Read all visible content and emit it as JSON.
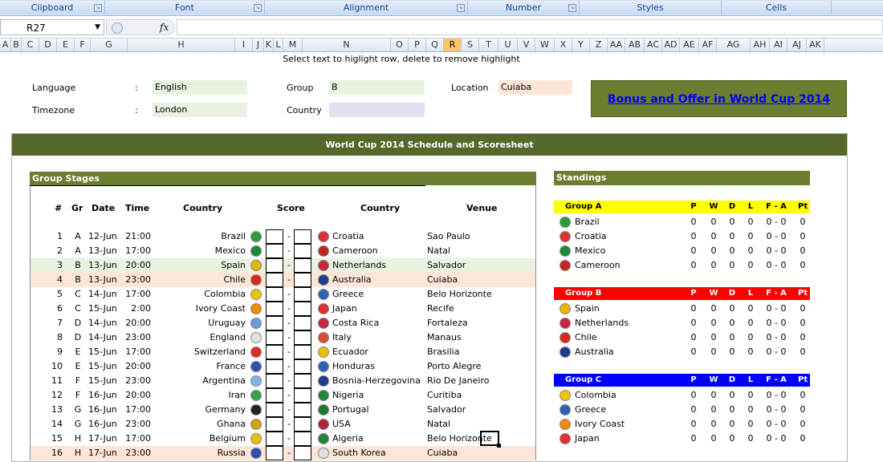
{
  "ribbon": {
    "groups": [
      "Clipboard",
      "Font",
      "Alignment",
      "Number",
      "Styles",
      "Cells"
    ]
  },
  "formula_bar": {
    "name_box": "R27",
    "fx": "fx",
    "formula": ""
  },
  "columns": [
    "A",
    "B",
    "C",
    "D",
    "E",
    "F",
    "G",
    "H",
    "I",
    "J",
    "K",
    "L",
    "M",
    "N",
    "O",
    "P",
    "Q",
    "R",
    "S",
    "T",
    "U",
    "V",
    "W",
    "X",
    "Y",
    "Z",
    "AA",
    "AB",
    "AC",
    "AD",
    "AE",
    "AF",
    "AG",
    "AH",
    "AI",
    "AJ",
    "AK"
  ],
  "selected_column": "R",
  "hint": "Select text to higlight row, delete to remove highlight",
  "settings": {
    "language_label": "Language",
    "language_value": "English",
    "timezone_label": "Timezone",
    "timezone_value": "London",
    "group_label": "Group",
    "group_value": "B",
    "country_label": "Country",
    "country_value": "",
    "location_label": "Location",
    "location_value": "Cuiaba",
    "colon": ":"
  },
  "banner": "Bonus and Offer in World Cup 2014",
  "main_title": "World Cup 2014 Schedule and Scoresheet",
  "group_stages": {
    "title": "Group Stages",
    "headers": {
      "num": "#",
      "gr": "Gr",
      "date": "Date",
      "time": "Time",
      "country_home": "Country",
      "score": "Score",
      "country_away": "Country",
      "venue": "Venue"
    },
    "matches": [
      {
        "num": "1",
        "gr": "A",
        "date": "12-Jun",
        "time": "21:00",
        "home": "Brazil",
        "away": "Croatia",
        "venue": "Sao Paulo",
        "hl": "",
        "home_flag": "#2a9d3a",
        "away_flag": "#d33"
      },
      {
        "num": "2",
        "gr": "A",
        "date": "13-Jun",
        "time": "17:00",
        "home": "Mexico",
        "away": "Cameroon",
        "venue": "Natal",
        "hl": "",
        "home_flag": "#1a8a3a",
        "away_flag": "#c2261f"
      },
      {
        "num": "3",
        "gr": "B",
        "date": "13-Jun",
        "time": "20:00",
        "home": "Spain",
        "away": "Netherlands",
        "venue": "Salvador",
        "hl": "green",
        "home_flag": "#e8b300",
        "away_flag": "#c8283c"
      },
      {
        "num": "4",
        "gr": "B",
        "date": "13-Jun",
        "time": "23:00",
        "home": "Chile",
        "away": "Australia",
        "venue": "Cuiaba",
        "hl": "peach",
        "home_flag": "#d52b1e",
        "away_flag": "#1f3b8c"
      },
      {
        "num": "5",
        "gr": "C",
        "date": "14-Jun",
        "time": "17:00",
        "home": "Colombia",
        "away": "Greece",
        "venue": "Belo Horizonte",
        "hl": "",
        "home_flag": "#f0c300",
        "away_flag": "#2f63b8"
      },
      {
        "num": "6",
        "gr": "C",
        "date": "15-Jun",
        "time": "2:00",
        "home": "Ivory Coast",
        "away": "Japan",
        "venue": "Recife",
        "hl": "",
        "home_flag": "#f08a00",
        "away_flag": "#e03030"
      },
      {
        "num": "7",
        "gr": "D",
        "date": "14-Jun",
        "time": "20:00",
        "home": "Uruguay",
        "away": "Costa Rica",
        "venue": "Fortaleza",
        "hl": "",
        "home_flag": "#6a9ad8",
        "away_flag": "#c8283c"
      },
      {
        "num": "8",
        "gr": "D",
        "date": "14-Jun",
        "time": "23:00",
        "home": "England",
        "away": "Italy",
        "venue": "Manaus",
        "hl": "",
        "home_flag": "#e0e0e0",
        "away_flag": "#d84a3a"
      },
      {
        "num": "9",
        "gr": "E",
        "date": "15-Jun",
        "time": "17:00",
        "home": "Switzerland",
        "away": "Ecuador",
        "venue": "Brasilia",
        "hl": "",
        "home_flag": "#e02828",
        "away_flag": "#e8c000"
      },
      {
        "num": "10",
        "gr": "E",
        "date": "15-Jun",
        "time": "20:00",
        "home": "France",
        "away": "Honduras",
        "venue": "Porto Alegre",
        "hl": "",
        "home_flag": "#3050b0",
        "away_flag": "#2e5fb0"
      },
      {
        "num": "11",
        "gr": "F",
        "date": "15-Jun",
        "time": "23:00",
        "home": "Argentina",
        "away": "Bosnia-Herzegovina",
        "venue": "Rio De Janeiro",
        "hl": "",
        "home_flag": "#7fb6e6",
        "away_flag": "#1f3b8c"
      },
      {
        "num": "12",
        "gr": "F",
        "date": "16-Jun",
        "time": "20:00",
        "home": "Iran",
        "away": "Nigeria",
        "venue": "Curitiba",
        "hl": "",
        "home_flag": "#3aa04a",
        "away_flag": "#1c8a3a"
      },
      {
        "num": "13",
        "gr": "G",
        "date": "16-Jun",
        "time": "17:00",
        "home": "Germany",
        "away": "Portugal",
        "venue": "Salvador",
        "hl": "",
        "home_flag": "#222",
        "away_flag": "#1a7a2a"
      },
      {
        "num": "14",
        "gr": "G",
        "date": "16-Jun",
        "time": "23:00",
        "home": "Ghana",
        "away": "USA",
        "venue": "Natal",
        "hl": "",
        "home_flag": "#d8a000",
        "away_flag": "#b22234"
      },
      {
        "num": "15",
        "gr": "H",
        "date": "17-Jun",
        "time": "17:00",
        "home": "Belgium",
        "away": "Algeria",
        "venue": "Belo Horizonte",
        "hl": "",
        "home_flag": "#e8c000",
        "away_flag": "#1c8a3a"
      },
      {
        "num": "16",
        "gr": "H",
        "date": "17-Jun",
        "time": "23:00",
        "home": "Russia",
        "away": "South Korea",
        "venue": "Cuiaba",
        "hl": "peach",
        "home_flag": "#2a50b0",
        "away_flag": "#e0e0e0"
      }
    ]
  },
  "standings": {
    "title": "Standings",
    "cols": [
      "P",
      "W",
      "D",
      "L",
      "F - A",
      "Pt"
    ],
    "groups": [
      {
        "name": "Group A",
        "color": "#ffff00",
        "text_color": "#000000",
        "teams": [
          {
            "team": "Brazil",
            "flag": "#2a9d3a",
            "p": "0",
            "w": "0",
            "d": "0",
            "l": "0",
            "fa": "0 - 0",
            "pt": "0"
          },
          {
            "team": "Croatia",
            "flag": "#d33",
            "p": "0",
            "w": "0",
            "d": "0",
            "l": "0",
            "fa": "0 - 0",
            "pt": "0"
          },
          {
            "team": "Mexico",
            "flag": "#1a8a3a",
            "p": "0",
            "w": "0",
            "d": "0",
            "l": "0",
            "fa": "0 - 0",
            "pt": "0"
          },
          {
            "team": "Cameroon",
            "flag": "#c2261f",
            "p": "0",
            "w": "0",
            "d": "0",
            "l": "0",
            "fa": "0 - 0",
            "pt": "0"
          }
        ]
      },
      {
        "name": "Group B",
        "color": "#ff0000",
        "text_color": "#ffffff",
        "teams": [
          {
            "team": "Spain",
            "flag": "#e8b300",
            "p": "0",
            "w": "0",
            "d": "0",
            "l": "0",
            "fa": "0 - 0",
            "pt": "0"
          },
          {
            "team": "Netherlands",
            "flag": "#c8283c",
            "p": "0",
            "w": "0",
            "d": "0",
            "l": "0",
            "fa": "0 - 0",
            "pt": "0"
          },
          {
            "team": "Chile",
            "flag": "#d52b1e",
            "p": "0",
            "w": "0",
            "d": "0",
            "l": "0",
            "fa": "0 - 0",
            "pt": "0"
          },
          {
            "team": "Australia",
            "flag": "#1f3b8c",
            "p": "0",
            "w": "0",
            "d": "0",
            "l": "0",
            "fa": "0 - 0",
            "pt": "0"
          }
        ]
      },
      {
        "name": "Group C",
        "color": "#0000ff",
        "text_color": "#ffffff",
        "teams": [
          {
            "team": "Colombia",
            "flag": "#f0c300",
            "p": "0",
            "w": "0",
            "d": "0",
            "l": "0",
            "fa": "0 - 0",
            "pt": "0"
          },
          {
            "team": "Greece",
            "flag": "#2f63b8",
            "p": "0",
            "w": "0",
            "d": "0",
            "l": "0",
            "fa": "0 - 0",
            "pt": "0"
          },
          {
            "team": "Ivory Coast",
            "flag": "#f08a00",
            "p": "0",
            "w": "0",
            "d": "0",
            "l": "0",
            "fa": "0 - 0",
            "pt": "0"
          },
          {
            "team": "Japan",
            "flag": "#e03030",
            "p": "0",
            "w": "0",
            "d": "0",
            "l": "0",
            "fa": "0 - 0",
            "pt": "0"
          }
        ]
      }
    ]
  },
  "colors": {
    "dark_green": "#55672a",
    "olive": "#6b7d2e",
    "highlight_green": "#e8f2df",
    "highlight_peach": "#fde6d8"
  }
}
